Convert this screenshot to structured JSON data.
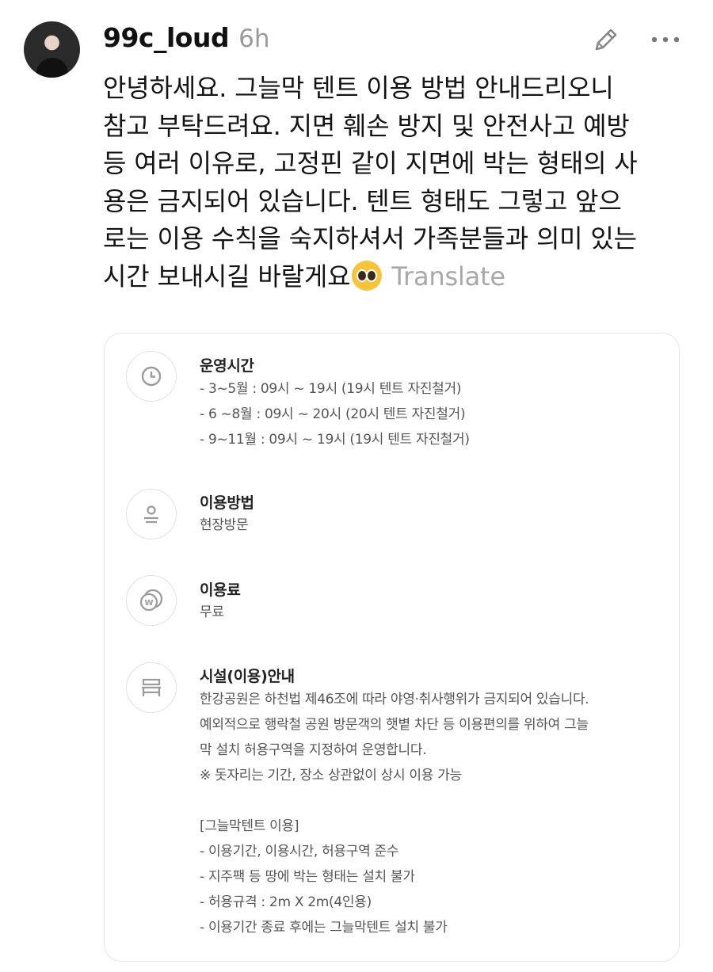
{
  "post": {
    "username": "99c_loud",
    "time": "6h",
    "lines": [
      "안녕하세요. 그늘막 텐트 이용 방법 안내드리오니",
      "참고 부탁드려요. 지면 훼손 방지 및 안전사고 예방",
      "등 여러 이유로, 고정핀 같이 지면에 박는 형태의 사",
      "용은 금지되어 있습니다. 텐트 형태도 그렇고 앞으",
      "로는 이용 수칙을 숙지하셔서 가족분들과 의미 있는",
      "시간 보내시길 바랄게요"
    ],
    "emoji": "pleading-face-emoji",
    "translate_label": "Translate"
  },
  "icons": {
    "edit": "pencil-icon",
    "more": "more-dots-icon",
    "clock": "clock-icon",
    "person": "person-icon",
    "fee": "won-coin-icon",
    "facility": "bench-icon"
  },
  "card": {
    "hours": {
      "title": "운영시간",
      "rows": [
        "- 3~5월 : 09시 ~ 19시  (19시 텐트 자진철거)",
        "- 6 ~8월 : 09시 ~ 20시  (20시 텐트 자진철거)",
        "- 9~11월 : 09시 ~ 19시  (19시 텐트 자진철거)"
      ]
    },
    "method": {
      "title": "이용방법",
      "rows": [
        "현장방문"
      ]
    },
    "fee": {
      "title": "이용료",
      "rows": [
        "무료"
      ]
    },
    "facility": {
      "title": "시설(이용)안내",
      "rows": [
        "한강공원은 하천법 제46조에 따라 야영·취사행위가 금지되어 있습니다.",
        "예외적으로 행락철 공원 방문객의 햇볕 차단 등 이용편의를 위하여 그늘",
        "막 설치 허용구역을 지정하여 운영합니다.",
        "※ 돗자리는 기간, 장소 상관없이 상시 이용 가능",
        "",
        "[그늘막텐트 이용]",
        "- 이용기간, 이용시간, 허용구역 준수",
        "- 지주팩 등 땅에 박는 형태는 설치 불가",
        "- 허용규격 : 2m X 2m(4인용)",
        "- 이용기간 종료 후에는 그늘막텐트 설치 불가"
      ]
    }
  }
}
